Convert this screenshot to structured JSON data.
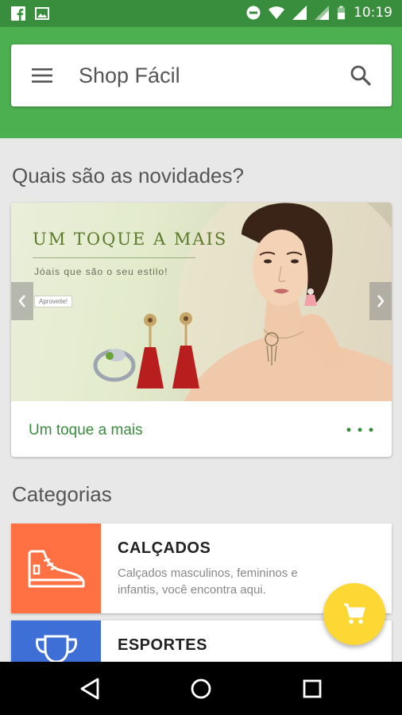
{
  "status_bar": {
    "time": "10:19",
    "left_icons": [
      "facebook-icon",
      "image-icon"
    ],
    "right_icons": [
      "do-not-disturb-icon",
      "wifi-icon",
      "signal-icon",
      "signal-icon",
      "battery-icon"
    ]
  },
  "app_bar": {
    "title": "Shop Fácil",
    "menu_icon": "menu-icon",
    "search_icon": "search-icon",
    "color": "#4caf50",
    "status_color": "#388e3c"
  },
  "news": {
    "title": "Quais são as novidades?",
    "banner": {
      "headline": "UM TOQUE A MAIS",
      "subtitle": "Jóais que são o seu estilo!",
      "cta": "Aproveite!"
    },
    "caption": "Um toque a mais",
    "more_icon": "more-horizontal-icon"
  },
  "categories": {
    "title": "Categorias",
    "items": [
      {
        "name": "CALÇADOS",
        "description": "Calçados masculinos, femininos e infantis, você encontra aqui.",
        "icon": "sneaker-icon",
        "color": "#ff7043"
      },
      {
        "name": "ESPORTES",
        "description": "",
        "icon": "trophy-icon",
        "color": "#3d6fd6"
      }
    ]
  },
  "fab": {
    "icon": "cart-icon",
    "color": "#fdd835"
  },
  "nav_bar": {
    "icons": [
      "back-icon",
      "home-icon",
      "recents-icon"
    ]
  }
}
